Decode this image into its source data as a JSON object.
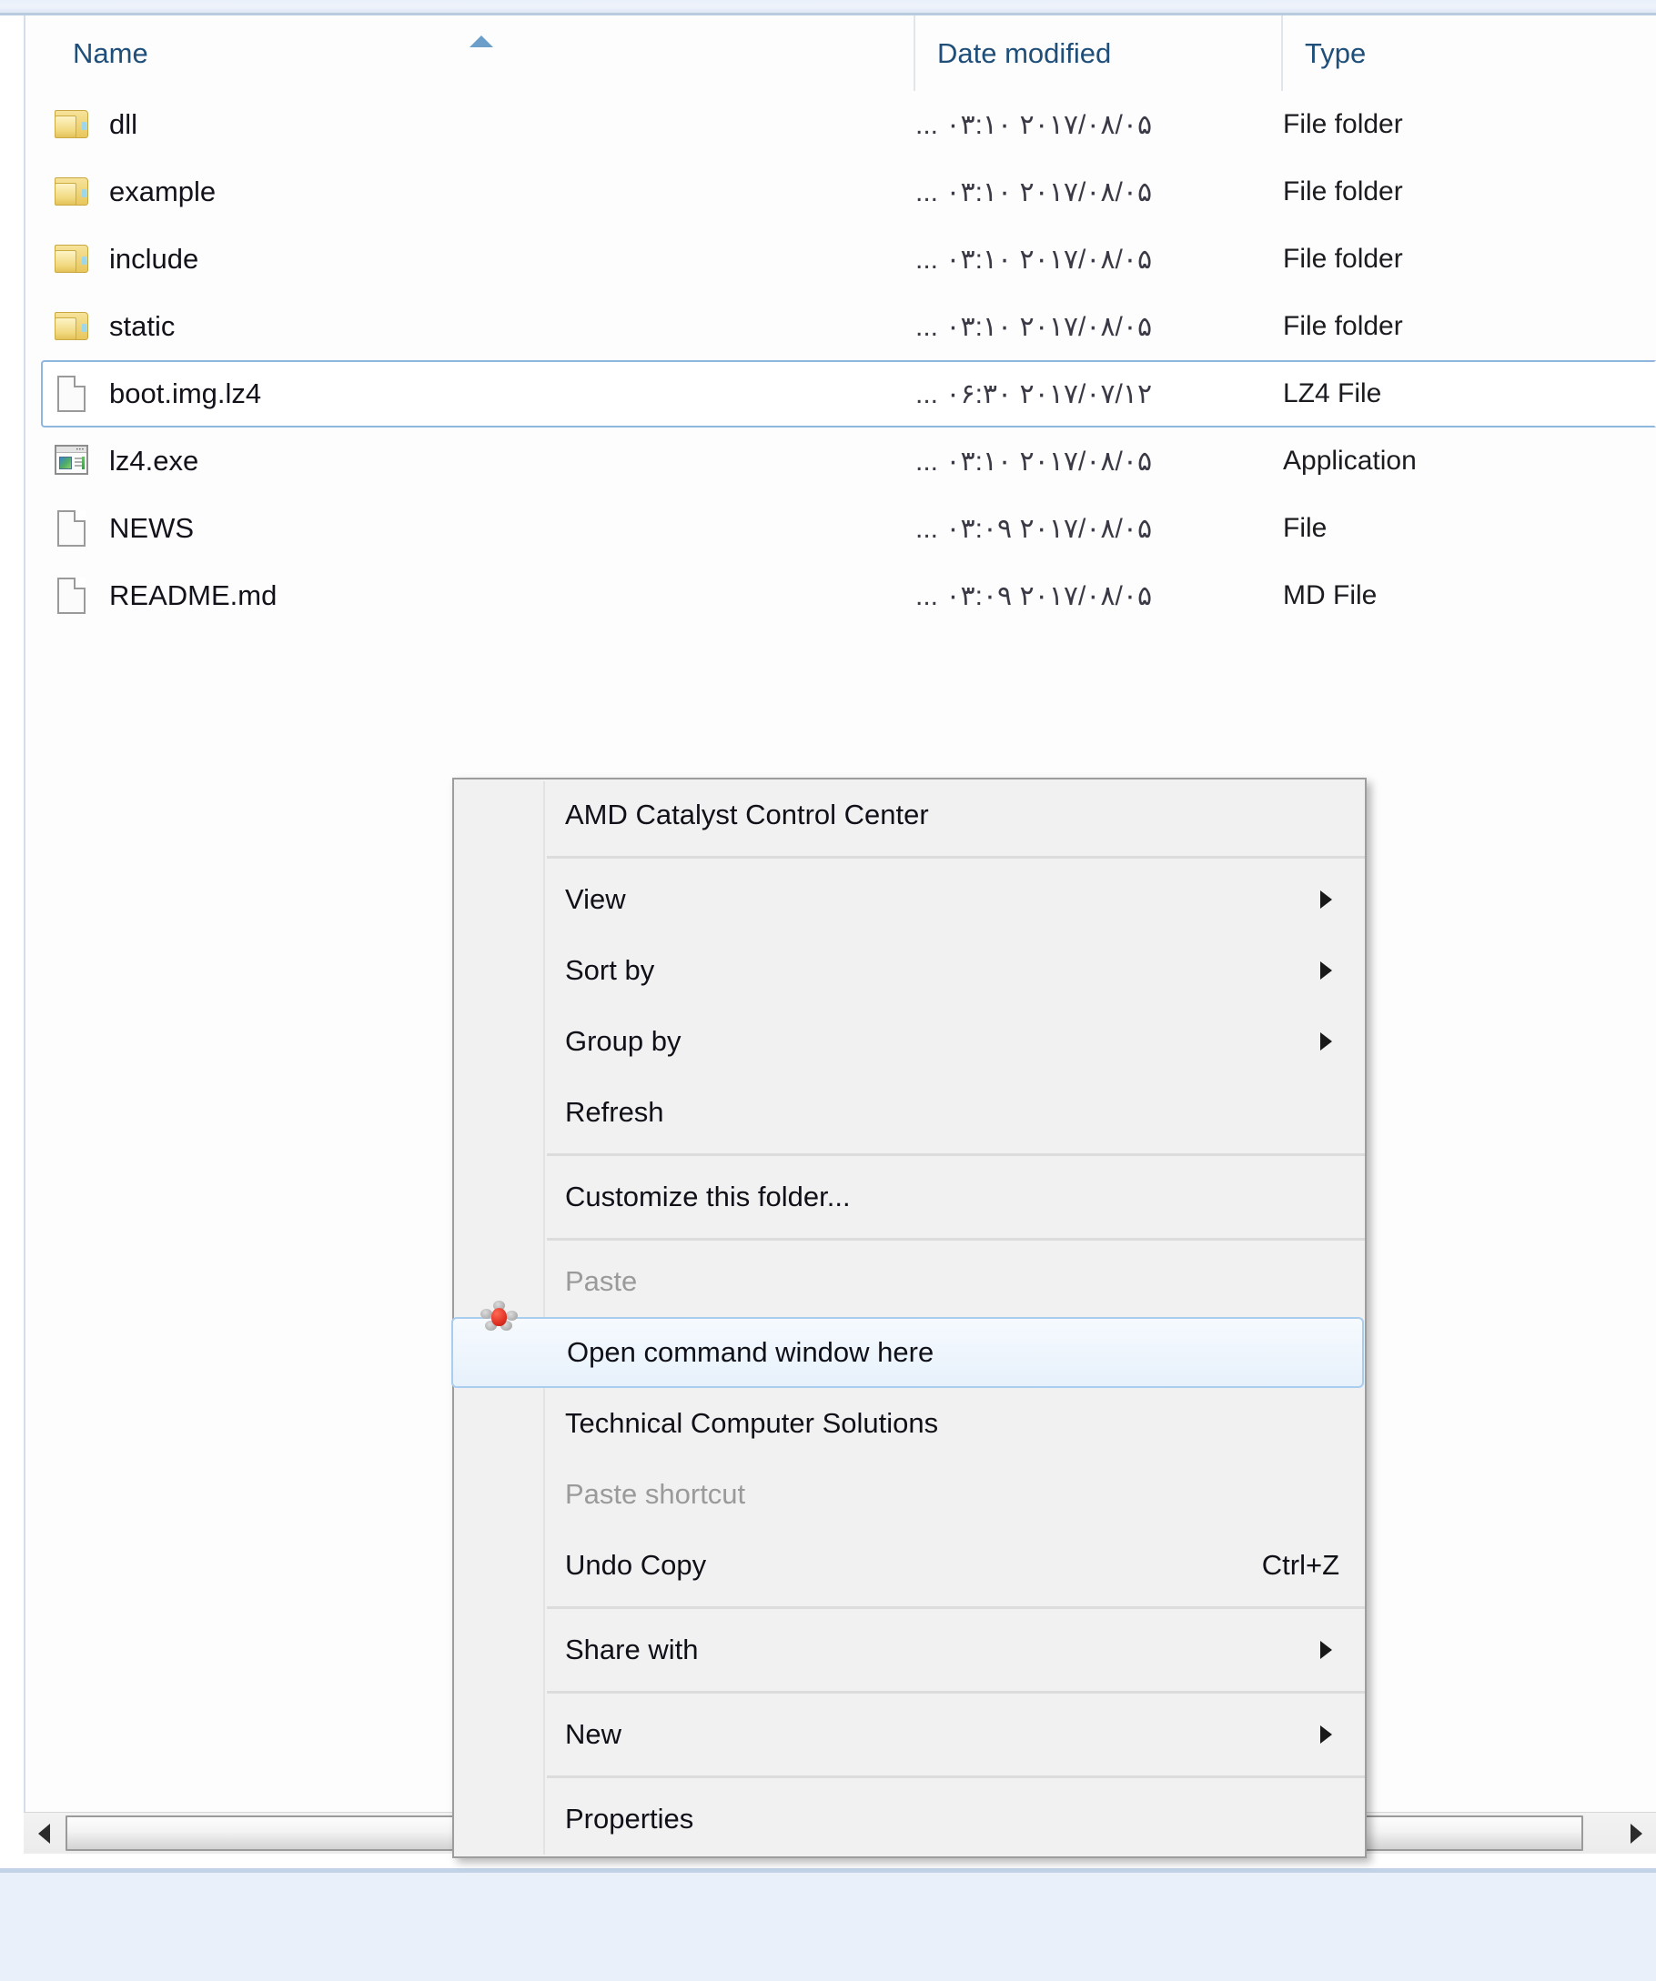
{
  "explorer": {
    "columns": [
      {
        "key": "name",
        "label": "Name"
      },
      {
        "key": "date",
        "label": "Date modified"
      },
      {
        "key": "type",
        "label": "Type"
      }
    ],
    "sort_indicator": "sort-ascending-arrow",
    "rows": [
      {
        "name": "dll",
        "date": "۲۰۱۷/۰۸/۰۵ ۰۳:۱۰ ...",
        "type": "File folder",
        "icon": "folder-icon",
        "selected": false
      },
      {
        "name": "example",
        "date": "۲۰۱۷/۰۸/۰۵ ۰۳:۱۰ ...",
        "type": "File folder",
        "icon": "folder-icon",
        "selected": false
      },
      {
        "name": "include",
        "date": "۲۰۱۷/۰۸/۰۵ ۰۳:۱۰ ...",
        "type": "File folder",
        "icon": "folder-icon",
        "selected": false
      },
      {
        "name": "static",
        "date": "۲۰۱۷/۰۸/۰۵ ۰۳:۱۰ ...",
        "type": "File folder",
        "icon": "folder-icon",
        "selected": false
      },
      {
        "name": "boot.img.lz4",
        "date": "۲۰۱۷/۰۷/۱۲ ۰۶:۳۰ ...",
        "type": "LZ4 File",
        "icon": "document-icon",
        "selected": true
      },
      {
        "name": "lz4.exe",
        "date": "۲۰۱۷/۰۸/۰۵ ۰۳:۱۰ ...",
        "type": "Application",
        "icon": "application-icon",
        "selected": false
      },
      {
        "name": "NEWS",
        "date": "۲۰۱۷/۰۸/۰۵ ۰۳:۰۹ ...",
        "type": "File",
        "icon": "document-icon",
        "selected": false
      },
      {
        "name": "README.md",
        "date": "۲۰۱۷/۰۸/۰۵ ۰۳:۰۹ ...",
        "type": "MD File",
        "icon": "document-icon",
        "selected": false
      }
    ],
    "scrollbar": {
      "left_arrow": "chevron-left-icon",
      "right_arrow": "chevron-right-icon"
    }
  },
  "context_menu": {
    "items": [
      {
        "label": "AMD Catalyst Control Center",
        "icon": "amd-catalyst-icon",
        "submenu": false,
        "disabled": false,
        "highlighted": false,
        "shortcut": ""
      },
      {
        "sep": true
      },
      {
        "label": "View",
        "submenu": true,
        "disabled": false,
        "highlighted": false,
        "shortcut": ""
      },
      {
        "label": "Sort by",
        "submenu": true,
        "disabled": false,
        "highlighted": false,
        "shortcut": ""
      },
      {
        "label": "Group by",
        "submenu": true,
        "disabled": false,
        "highlighted": false,
        "shortcut": ""
      },
      {
        "label": "Refresh",
        "submenu": false,
        "disabled": false,
        "highlighted": false,
        "shortcut": ""
      },
      {
        "sep": true
      },
      {
        "label": "Customize this folder...",
        "submenu": false,
        "disabled": false,
        "highlighted": false,
        "shortcut": ""
      },
      {
        "sep": true
      },
      {
        "label": "Paste",
        "submenu": false,
        "disabled": true,
        "highlighted": false,
        "shortcut": ""
      },
      {
        "label": "Open command window here",
        "submenu": false,
        "disabled": false,
        "highlighted": true,
        "shortcut": ""
      },
      {
        "label": "Technical Computer Solutions",
        "submenu": false,
        "disabled": false,
        "highlighted": false,
        "shortcut": ""
      },
      {
        "label": "Paste shortcut",
        "submenu": false,
        "disabled": true,
        "highlighted": false,
        "shortcut": ""
      },
      {
        "label": "Undo Copy",
        "submenu": false,
        "disabled": false,
        "highlighted": false,
        "shortcut": "Ctrl+Z"
      },
      {
        "sep": true
      },
      {
        "label": "Share with",
        "submenu": true,
        "disabled": false,
        "highlighted": false,
        "shortcut": ""
      },
      {
        "sep": true
      },
      {
        "label": "New",
        "submenu": true,
        "disabled": false,
        "highlighted": false,
        "shortcut": ""
      },
      {
        "sep": true
      },
      {
        "label": "Properties",
        "submenu": false,
        "disabled": false,
        "highlighted": false,
        "shortcut": ""
      }
    ]
  },
  "colors": {
    "header_text": "#1f4e79",
    "selection_border": "#8fb6dd",
    "menu_highlight_border": "#a8cdef",
    "desktop_bg": "#eaf0fa",
    "folder_yellow": "#e9c75e"
  }
}
